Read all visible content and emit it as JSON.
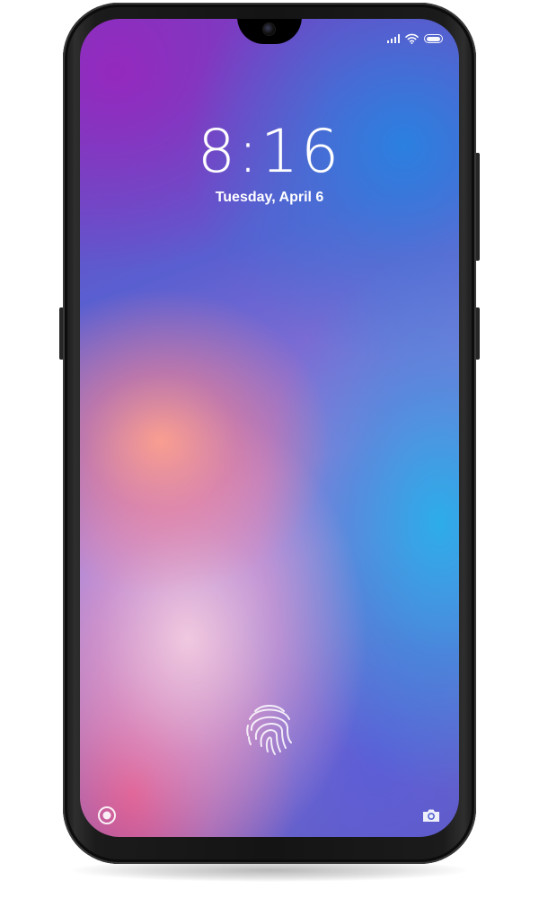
{
  "lock_screen": {
    "time": "8:16",
    "date": "Tuesday, April 6"
  },
  "status_bar": {
    "icons": [
      "signal-icon",
      "wifi-icon",
      "battery-icon"
    ]
  },
  "shortcuts": {
    "left": "camera-record-icon",
    "right": "camera-icon"
  },
  "unlock": {
    "icon": "fingerprint-icon"
  },
  "colors": {
    "frame": "#1a1a1a",
    "accent_purple": "#7a36c0",
    "accent_blue": "#2ea8e8",
    "accent_coral": "#f59a8c",
    "text": "#ffffff"
  }
}
